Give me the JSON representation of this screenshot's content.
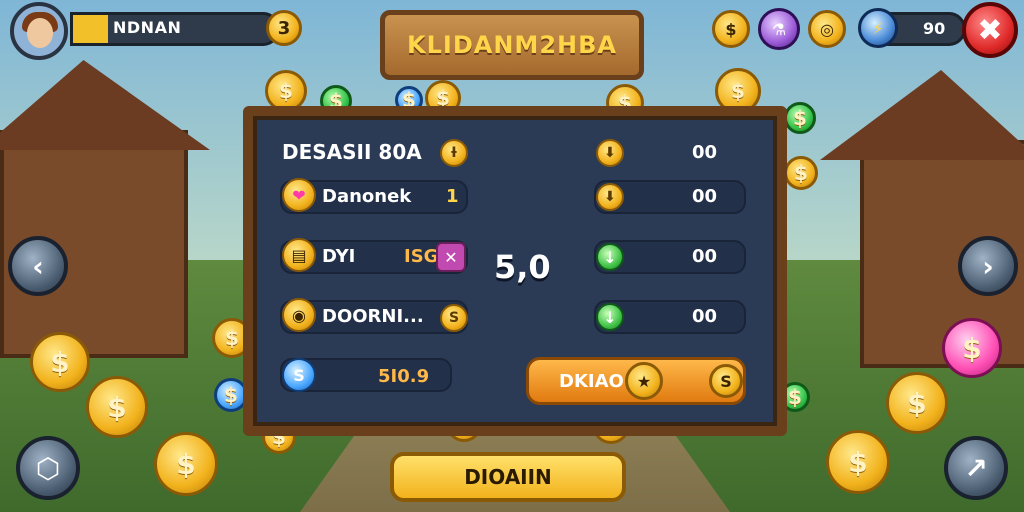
{
  "player": {
    "name": "NDNAN",
    "level_badge": "3",
    "progress_fraction": 0.17
  },
  "title": {
    "text": "KLIDANM2HBA"
  },
  "top_right": {
    "currency_value": "90",
    "close_label": "✖"
  },
  "panel": {
    "left_rows": [
      {
        "label": "DESASII 80A",
        "badge": "Ɨ"
      },
      {
        "label": "Danonek",
        "value": "1"
      },
      {
        "label": "DYI",
        "value": "ISG"
      },
      {
        "label": "DOORNI...",
        "badge": "S"
      },
      {
        "label": "S",
        "value": "5I0.9"
      }
    ],
    "center_value": "5,0",
    "right_rows": [
      {
        "value": "00"
      },
      {
        "value": "00"
      },
      {
        "value": "00"
      },
      {
        "value": "00"
      }
    ],
    "button_orange": {
      "label": "DKIAO",
      "coin_label": "S"
    }
  },
  "bottom_button": {
    "label": "DIOAIIN"
  },
  "icons": {
    "left_arrow": "‹",
    "right_arrow": "›",
    "dollar": "$",
    "share_arrow": "↗"
  }
}
